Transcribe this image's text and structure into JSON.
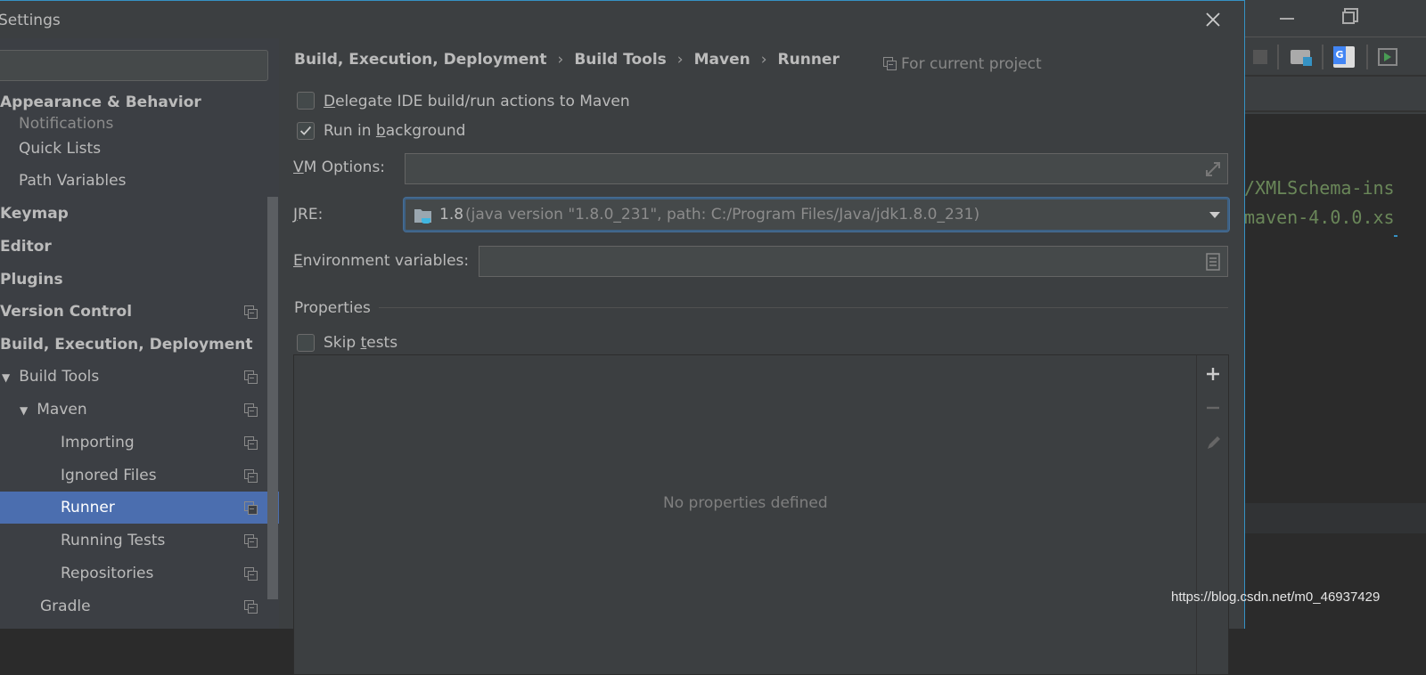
{
  "dialog": {
    "title": "Settings"
  },
  "sidebar": {
    "search_value": "",
    "items": [
      {
        "label": "Appearance & Behavior"
      },
      {
        "label": "Notifications"
      },
      {
        "label": "Quick Lists"
      },
      {
        "label": "Path Variables"
      },
      {
        "label": "Keymap"
      },
      {
        "label": "Editor"
      },
      {
        "label": "Plugins"
      },
      {
        "label": "Version Control"
      },
      {
        "label": "Build, Execution, Deployment"
      },
      {
        "label": "Build Tools"
      },
      {
        "label": "Maven"
      },
      {
        "label": "Importing"
      },
      {
        "label": "Ignored Files"
      },
      {
        "label": "Runner"
      },
      {
        "label": "Running Tests"
      },
      {
        "label": "Repositories"
      },
      {
        "label": "Gradle"
      }
    ]
  },
  "breadcrumb": [
    "Build, Execution, Deployment",
    "Build Tools",
    "Maven",
    "Runner"
  ],
  "scope": "For current project",
  "form": {
    "delegate": {
      "key": "D",
      "rest": "elegate IDE build/run actions to Maven",
      "checked": false
    },
    "background": {
      "pre": "Run in ",
      "key": "b",
      "rest": "ackground",
      "checked": true
    },
    "vm_options": {
      "key": "V",
      "rest": "M Options:",
      "value": ""
    },
    "jre": {
      "key": "J",
      "rest": "RE:",
      "version": "1.8",
      "detail": "(java version \"1.8.0_231\", path: C:/Program Files/Java/jdk1.8.0_231)"
    },
    "env": {
      "key": "E",
      "rest": "nvironment variables:",
      "value": ""
    },
    "properties_title": "Properties",
    "skip": {
      "pre": "Skip ",
      "key": "t",
      "rest": "ests",
      "checked": false
    },
    "empty_text": "No properties defined"
  },
  "editor": {
    "lines": [
      "/XMLSchema-ins",
      "maven-4.0.0.xs"
    ]
  },
  "watermark": "https://blog.csdn.net/m0_46937429",
  "colors": {
    "selection": "#4b6eaf",
    "accent": "#3592c4",
    "code_string": "#6a8759"
  }
}
